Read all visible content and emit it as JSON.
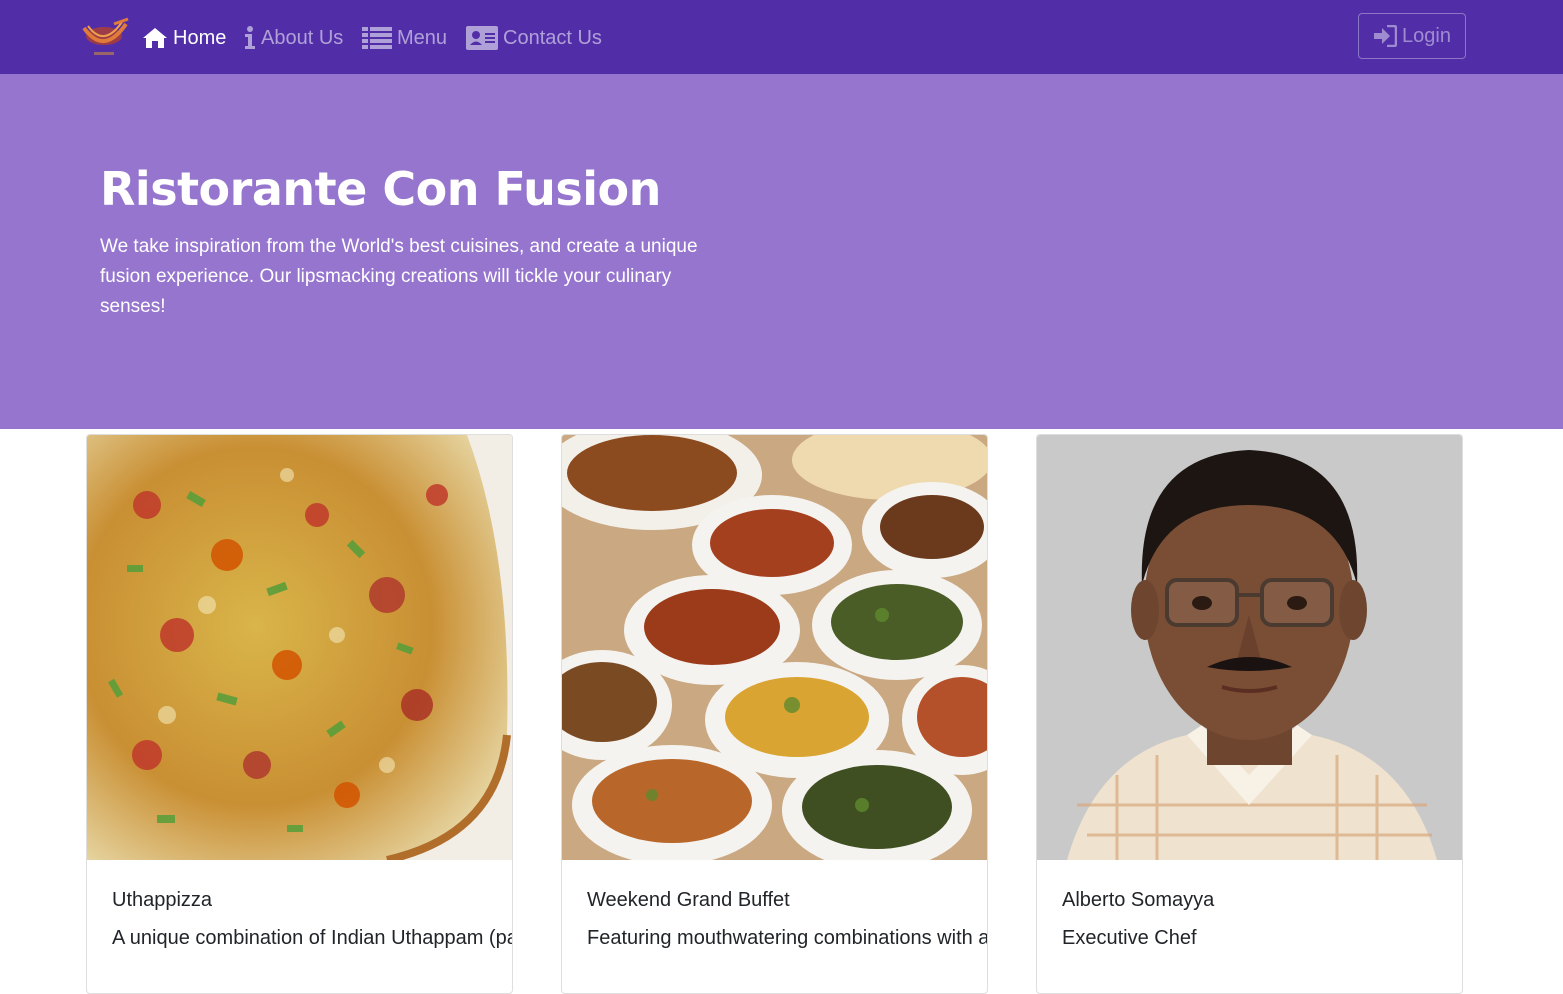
{
  "nav": {
    "logo_icon": "restaurant-logo-icon",
    "items": [
      {
        "label": "Home",
        "icon": "home-icon",
        "active": true
      },
      {
        "label": "About Us",
        "icon": "info-icon",
        "active": false
      },
      {
        "label": "Menu",
        "icon": "list-icon",
        "active": false
      },
      {
        "label": "Contact Us",
        "icon": "address-card-icon",
        "active": false
      }
    ],
    "login_label": "Login",
    "login_icon": "sign-in-icon"
  },
  "jumbotron": {
    "title": "Ristorante Con Fusion",
    "text": "We take inspiration from the World's best cuisines, and create a unique fusion experience. Our lipsmacking creations will tickle your culinary senses!"
  },
  "cards": [
    {
      "title": "Uthappizza",
      "text": "A unique combination of Indian Uthappam (pancake) and Italian pizza",
      "image": "uthappizza-photo"
    },
    {
      "title": "Weekend Grand Buffet",
      "text": "Featuring mouthwatering combinations with a choice",
      "image": "buffet-photo"
    },
    {
      "title": "Alberto Somayya",
      "text": "Executive Chef",
      "image": "chef-portrait-photo"
    }
  ],
  "colors": {
    "navbar": "#512da8",
    "jumbotron": "#9575cd",
    "text_dark": "#212529"
  }
}
